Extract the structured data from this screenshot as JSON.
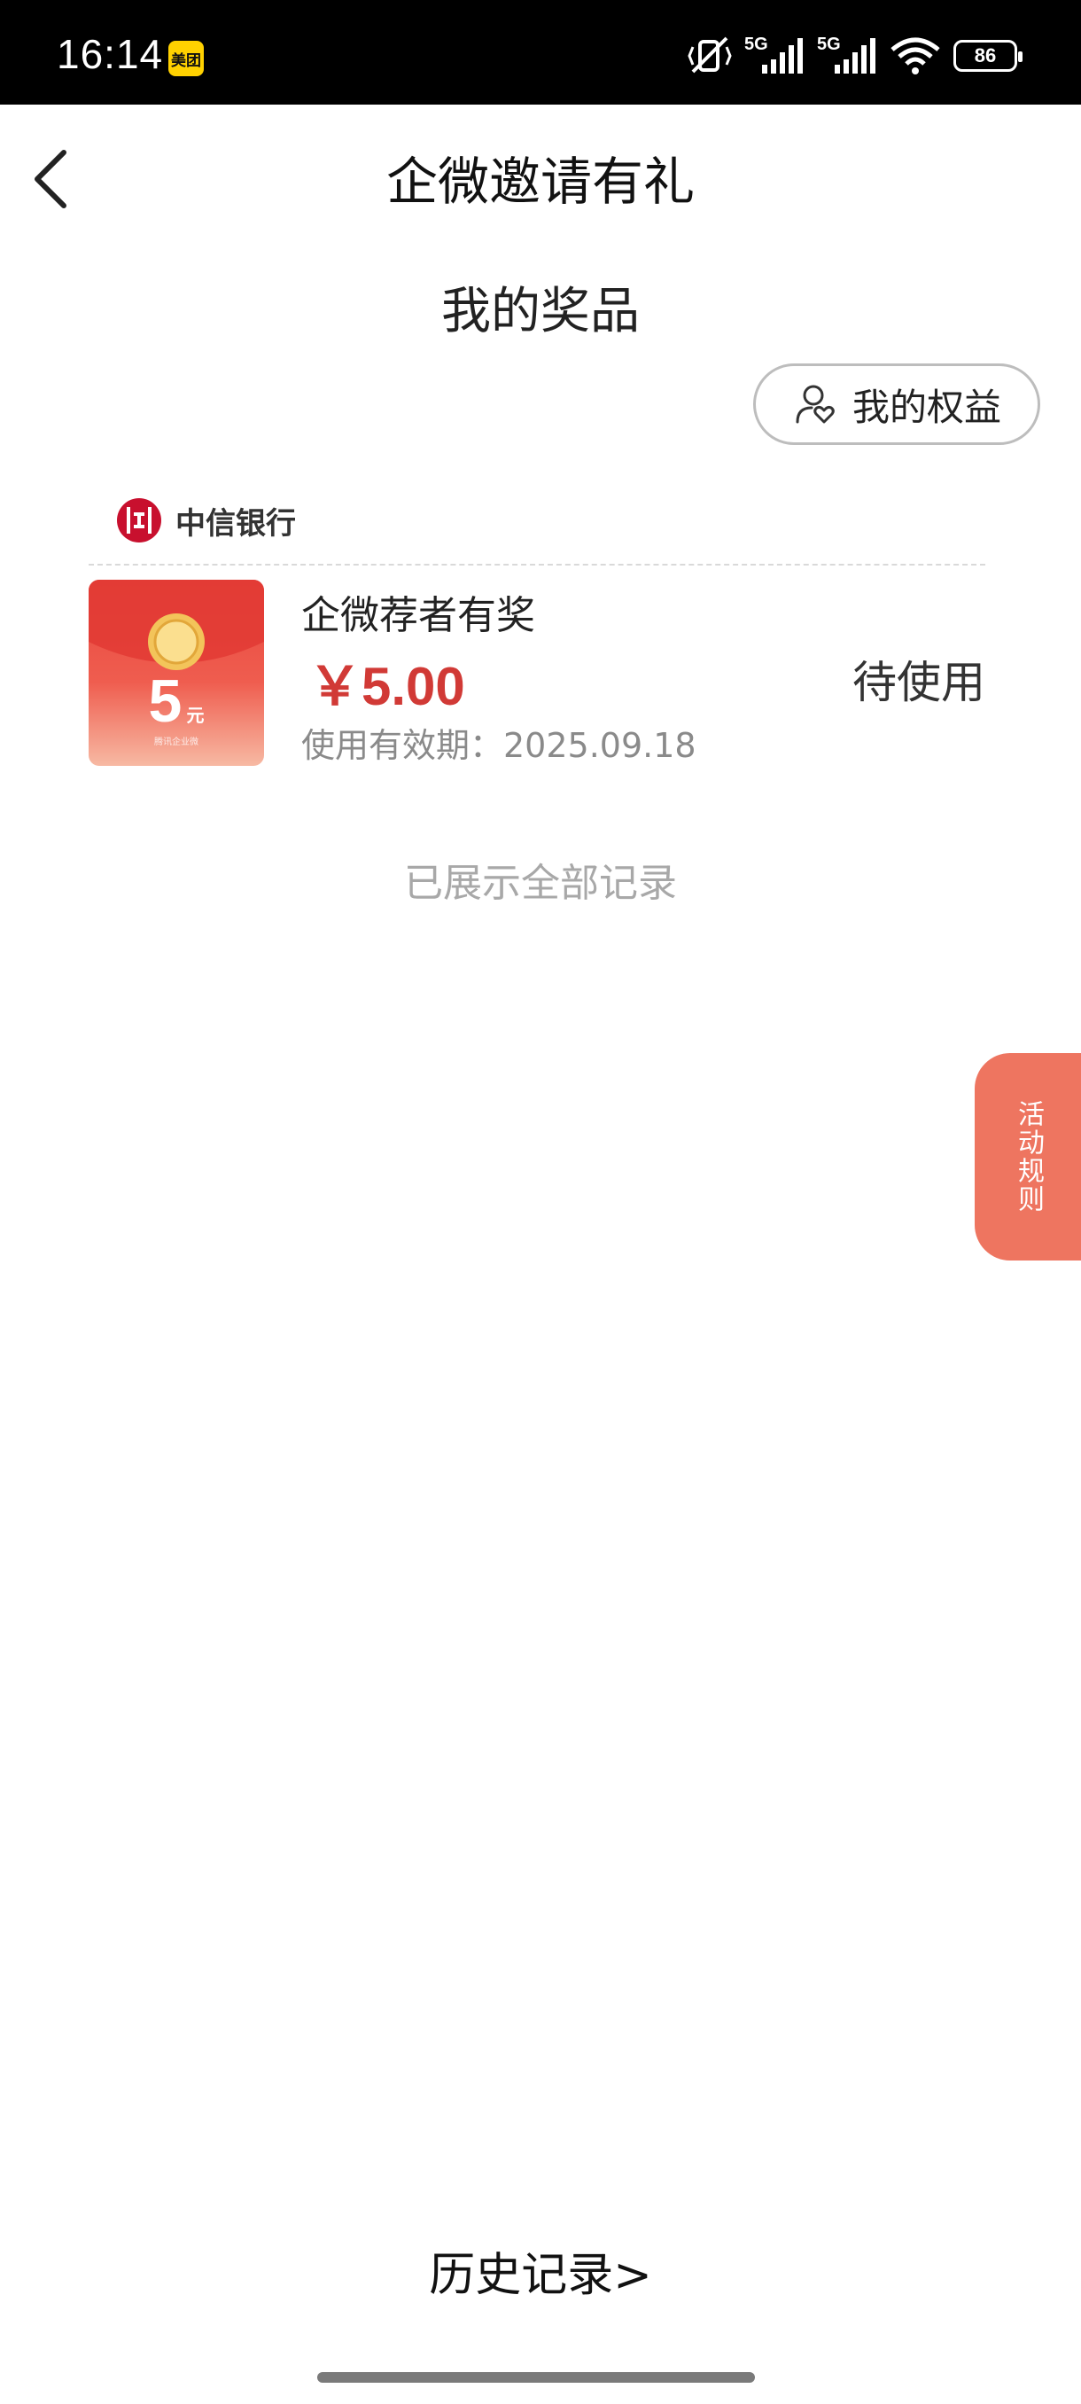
{
  "status_bar": {
    "time": "16:14",
    "app_badge": "美团",
    "network_label_1": "5G",
    "network_label_2": "5G",
    "battery": "86"
  },
  "nav": {
    "title": "企微邀请有礼",
    "back_icon": "chevron-left-icon"
  },
  "section_title": "我的奖品",
  "benefits_button": {
    "label": "我的权益",
    "icon": "user-heart-icon"
  },
  "bank": {
    "name": "中信银行",
    "logo_icon": "citic-bank-logo"
  },
  "prizes": [
    {
      "name": "企微荐者有奖",
      "amount": "￥5.00",
      "expiry": "使用有效期：2025.09.18",
      "status": "待使用",
      "envelope_value": "5",
      "envelope_unit": "元",
      "envelope_caption": "腾讯企业微"
    }
  ],
  "all_records_shown": "已展示全部记录",
  "rules_tab": "活动规则",
  "history_link": "历史记录>",
  "colors": {
    "accent_red": "#d13a36",
    "rules_tab": "#ee7560",
    "status_bar": "#000000"
  }
}
